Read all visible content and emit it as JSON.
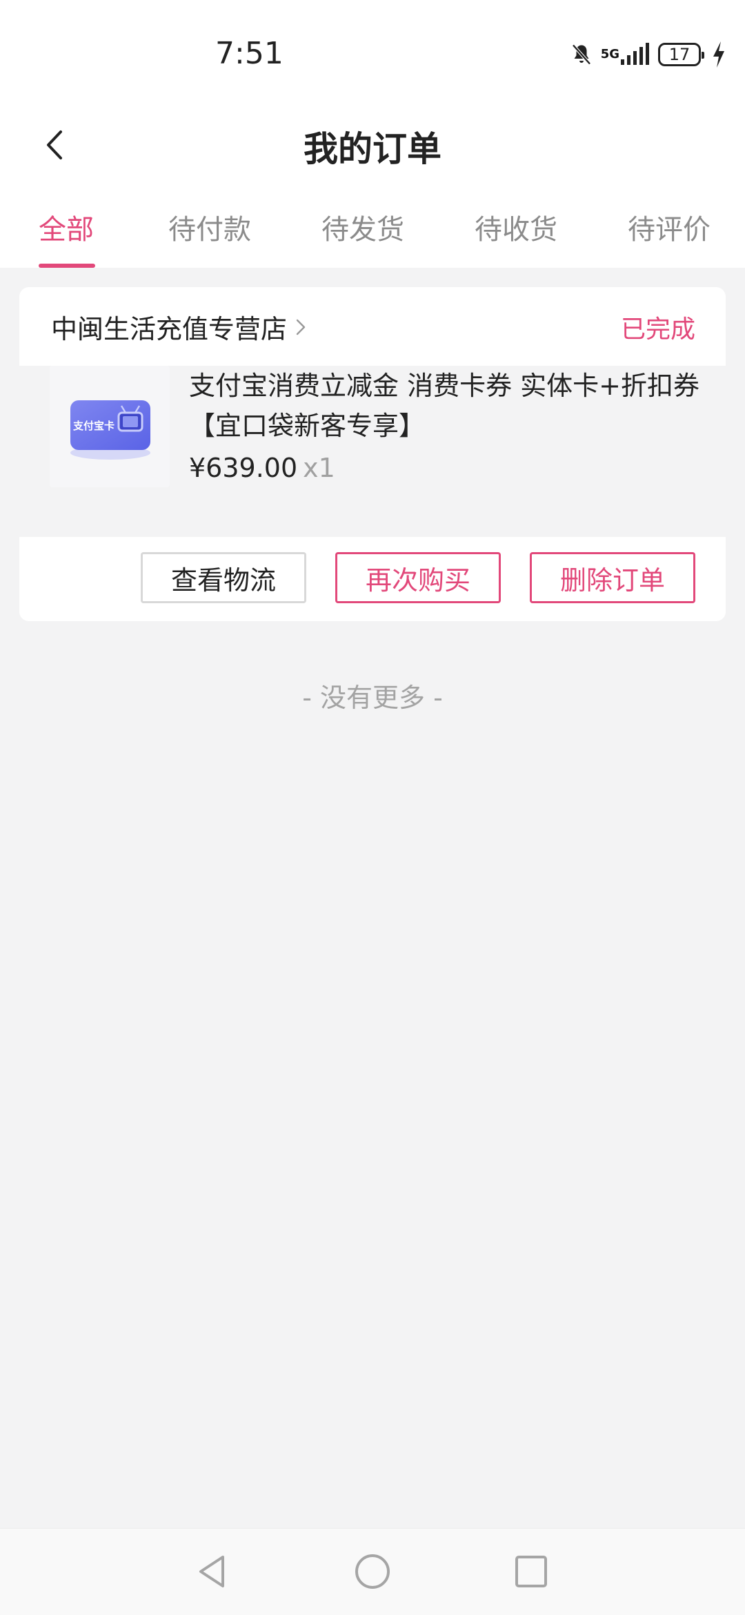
{
  "status_bar": {
    "time": "7:51",
    "network": "5G",
    "battery": "17",
    "icons": [
      "mute-bell-icon",
      "signal-icon",
      "battery-icon",
      "charging-icon"
    ]
  },
  "header": {
    "title": "我的订单",
    "back_icon": "chevron-left-icon"
  },
  "tabs": [
    {
      "label": "全部",
      "active": true
    },
    {
      "label": "待付款",
      "active": false
    },
    {
      "label": "待发货",
      "active": false
    },
    {
      "label": "待收货",
      "active": false
    },
    {
      "label": "待评价",
      "active": false
    }
  ],
  "order": {
    "shop_name": "中闽生活充值专营店",
    "status": "已完成",
    "thumbnail_text": "支付宝卡",
    "product_title": "支付宝消费立减金 消费卡券 实体卡+折扣券【宜口袋新客专享】",
    "price": "¥639.00",
    "quantity": "x1",
    "actions": {
      "logistics": "查看物流",
      "buy_again": "再次购买",
      "delete": "删除订单"
    }
  },
  "footer_text": "- 没有更多 -",
  "nav_bar": {
    "icons": [
      "back-triangle-icon",
      "home-circle-icon",
      "recents-square-icon"
    ]
  },
  "colors": {
    "accent": "#e2487a",
    "background": "#f3f3f4",
    "muted_text": "#8b8b8b"
  }
}
